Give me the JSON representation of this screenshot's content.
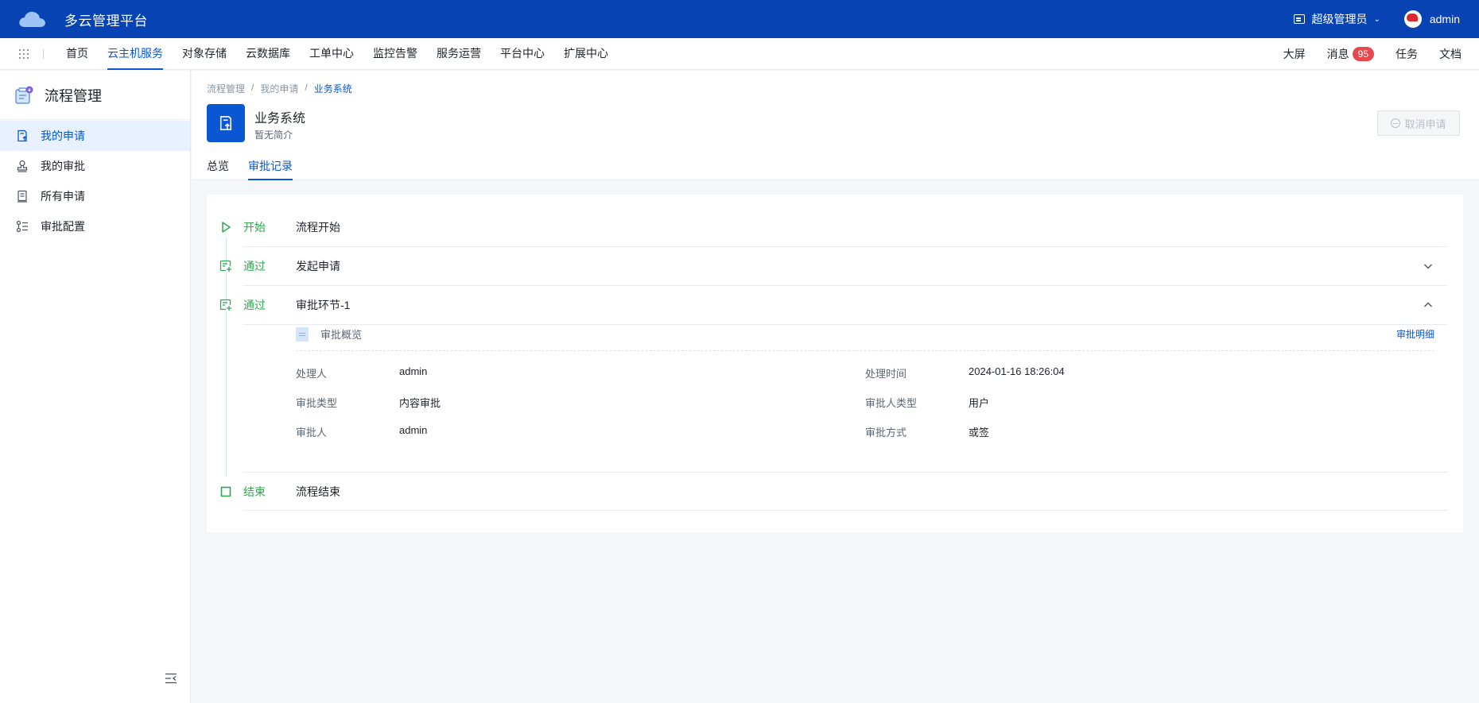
{
  "topbar": {
    "app_title": "多云管理平台",
    "role": "超级管理员",
    "user": "admin"
  },
  "nav": {
    "items": [
      {
        "label": "首页"
      },
      {
        "label": "云主机服务",
        "active": true
      },
      {
        "label": "对象存储"
      },
      {
        "label": "云数据库"
      },
      {
        "label": "工单中心"
      },
      {
        "label": "监控告警"
      },
      {
        "label": "服务运营"
      },
      {
        "label": "平台中心"
      },
      {
        "label": "扩展中心"
      }
    ],
    "right": {
      "screen": "大屏",
      "messages": "消息",
      "message_count": "95",
      "tasks": "任务",
      "docs": "文档"
    }
  },
  "sidebar": {
    "title": "流程管理",
    "items": [
      {
        "label": "我的申请",
        "icon": "my-request-icon",
        "active": true
      },
      {
        "label": "我的审批",
        "icon": "stamp-icon"
      },
      {
        "label": "所有申请",
        "icon": "document-list-icon"
      },
      {
        "label": "审批配置",
        "icon": "config-list-icon"
      }
    ]
  },
  "header": {
    "breadcrumb": [
      "流程管理",
      "我的申请",
      "业务系统"
    ],
    "app_name": "业务系统",
    "app_desc": "暂无简介",
    "cancel_label": "取消申请",
    "tabs": [
      {
        "label": "总览"
      },
      {
        "label": "审批记录",
        "active": true
      }
    ]
  },
  "timeline": {
    "steps": [
      {
        "status": "开始",
        "name": "流程开始"
      },
      {
        "status": "通过",
        "name": "发起申请",
        "expanded": false
      },
      {
        "status": "通过",
        "name": "审批环节-1",
        "expanded": true
      },
      {
        "status": "结束",
        "name": "流程结束"
      }
    ],
    "detail": {
      "title": "审批概览",
      "link": "审批明细",
      "fields": [
        {
          "key": "处理人",
          "value": "admin"
        },
        {
          "key": "处理时间",
          "value": "2024-01-16 18:26:04"
        },
        {
          "key": "审批类型",
          "value": "内容审批"
        },
        {
          "key": "审批人类型",
          "value": "用户"
        },
        {
          "key": "审批人",
          "value": "admin"
        },
        {
          "key": "审批方式",
          "value": "或签"
        }
      ]
    }
  },
  "colors": {
    "topbar": "#0743b3",
    "accent": "#0a56d3",
    "success": "#2fa84f",
    "badge": "#e5484d"
  }
}
